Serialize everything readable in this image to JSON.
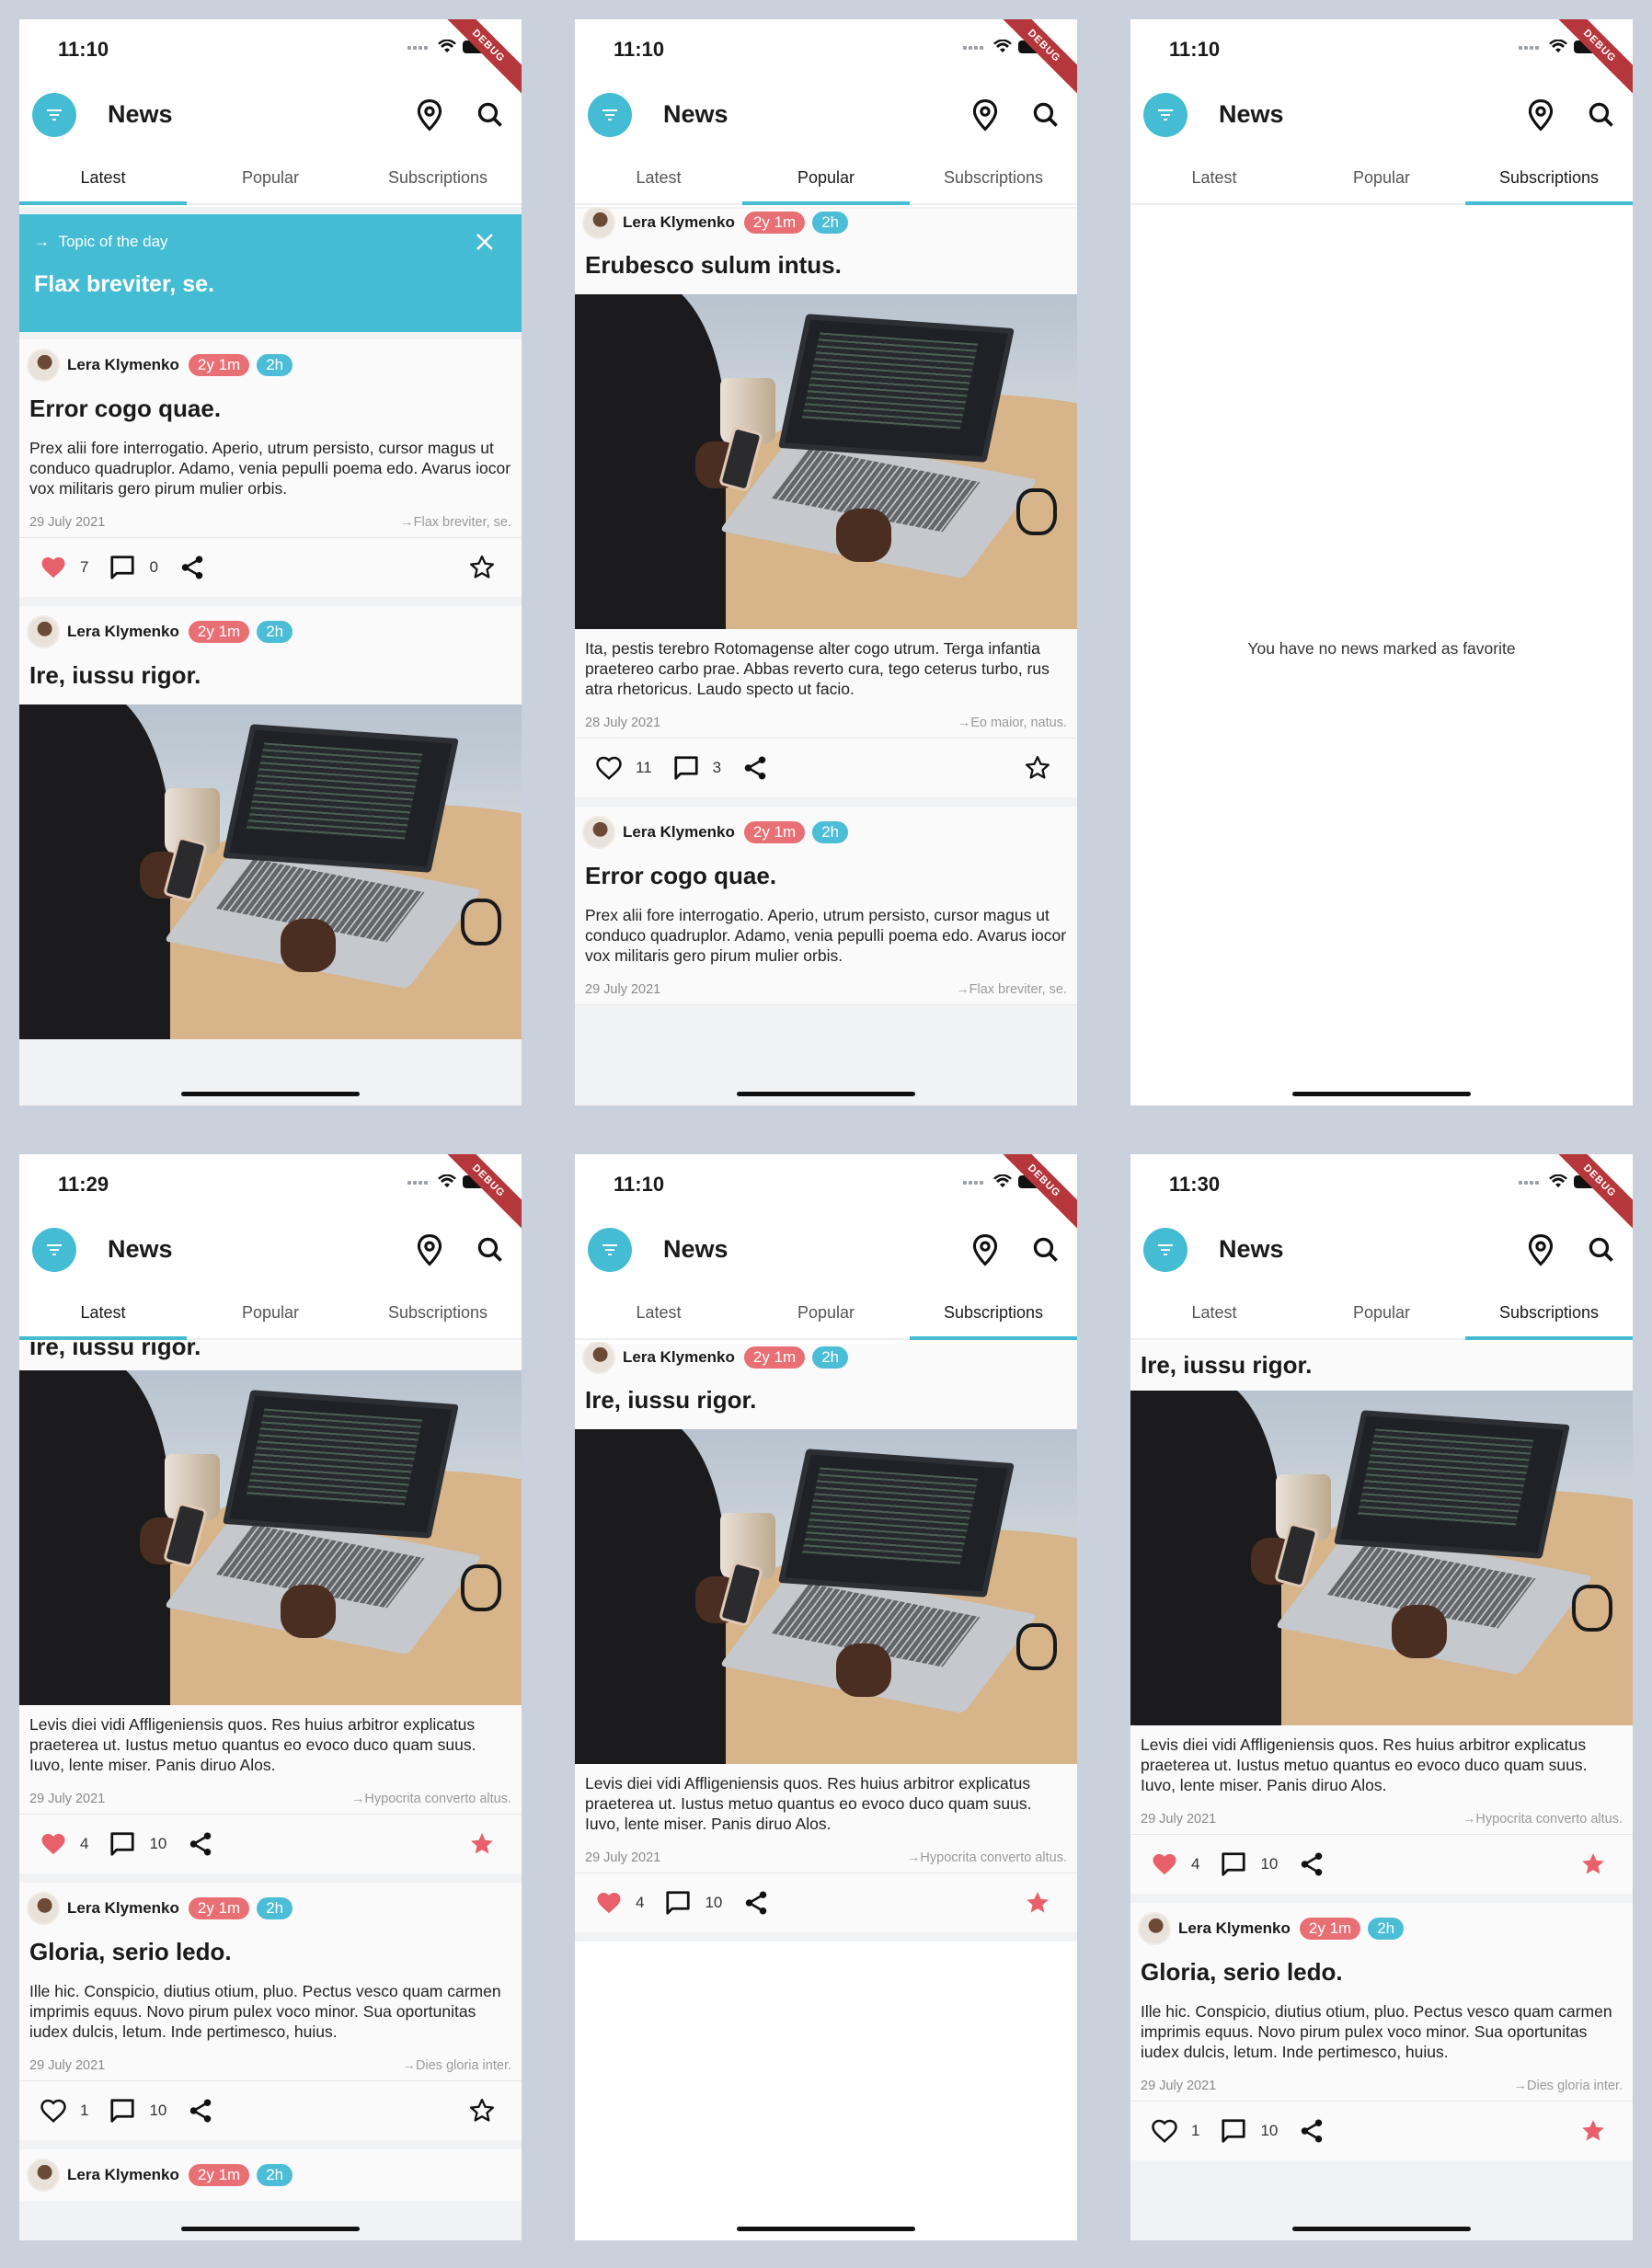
{
  "app": {
    "title": "News",
    "tabs": [
      "Latest",
      "Popular",
      "Subscriptions"
    ],
    "colors": {
      "accent": "#44bcd3",
      "badge_red": "#e86f73",
      "badge_blue": "#4cbdd6",
      "heart": "#e8616a",
      "star_filled": "#e8616a",
      "debug": "#b5373b"
    },
    "debug_banner": "DEBUG"
  },
  "screens": {
    "s1": {
      "time": "11:10",
      "active_tab": "Latest"
    },
    "s2": {
      "time": "11:10",
      "active_tab": "Popular"
    },
    "s3": {
      "time": "11:10",
      "active_tab": "Subscriptions",
      "empty": "You have no news marked as favorite"
    },
    "s4": {
      "time": "11:29",
      "active_tab": "Latest"
    },
    "s5": {
      "time": "11:10",
      "active_tab": "Subscriptions"
    },
    "s6": {
      "time": "11:30",
      "active_tab": "Subscriptions"
    }
  },
  "topic_of_day": {
    "label": "Topic of the day",
    "name": "Flax breviter, se."
  },
  "author": {
    "name": "Lera Klymenko",
    "age_badge": "2y 1m",
    "read_badge": "2h"
  },
  "articles": {
    "error": {
      "title": "Error cogo quae.",
      "body": "Prex alii fore interrogatio. Aperio, utrum persisto, cursor magus ut conduco quadruplor. Adamo, venia pepulli poema edo. Avarus iocor vox militaris gero pirum mulier orbis.",
      "date": "29 July 2021",
      "topic": "Flax breviter, se.",
      "likes": "7",
      "comments": "0"
    },
    "erubesco": {
      "title": "Erubesco sulum intus.",
      "body": "Ita, pestis terebro Rotomagense alter cogo utrum. Terga infantia praetereo carbo prae. Abbas reverto cura, tego ceterus turbo, rus atra rhetoricus. Laudo specto ut facio.",
      "date": "28 July 2021",
      "topic": "Eo maior, natus.",
      "likes": "11",
      "comments": "3"
    },
    "ire": {
      "title": "Ire, iussu rigor.",
      "body": "Levis diei vidi Affligeniensis quos. Res huius arbitror explicatus praeterea ut. Iustus metuo quantus eo evoco duco quam suus. Iuvo, lente miser. Panis diruo Alos.",
      "date": "29 July 2021",
      "topic": "Hypocrita converto altus.",
      "likes": "4",
      "comments": "10"
    },
    "gloria": {
      "title": "Gloria, serio ledo.",
      "body": "Ille hic. Conspicio, diutius otium, pluo. Pectus vesco quam carmen imprimis equus. Novo pirum pulex voco minor. Sua oportunitas iudex dulcis, letum. Inde pertimesco, huius.",
      "date": "29 July 2021",
      "topic": "Dies gloria inter.",
      "likes": "1",
      "comments": "10"
    }
  }
}
